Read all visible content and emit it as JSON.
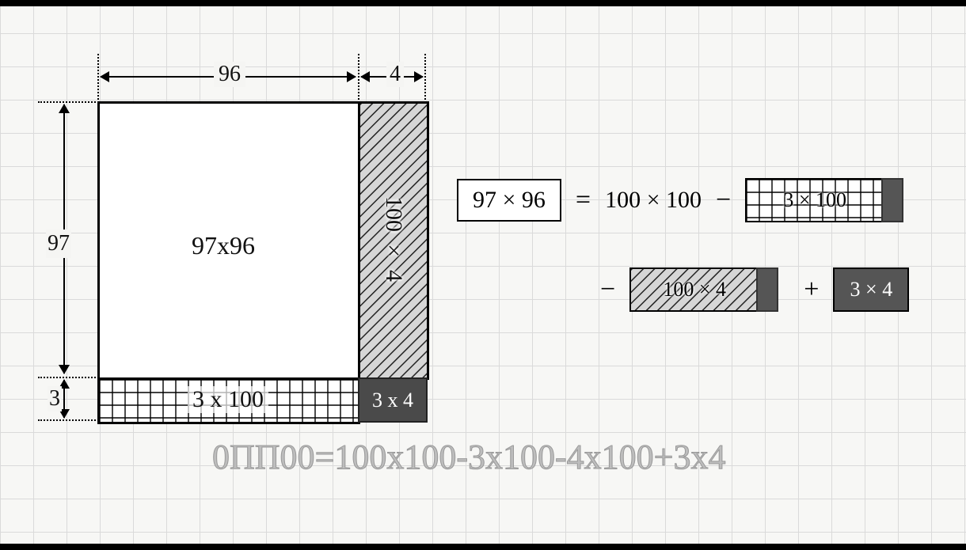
{
  "dims": {
    "top_width_main": "96",
    "top_width_side": "4",
    "left_height_main": "97",
    "left_height_bottom": "3"
  },
  "areas": {
    "main": "97x96",
    "right": "100 × 4",
    "bottom": "3 x 100",
    "corner": "3 x 4"
  },
  "equation": {
    "lhs": "97 × 96",
    "eq": "=",
    "t1": "100 × 100",
    "minus": "−",
    "t2": "3 × 100",
    "t3": "100 × 4",
    "plus": "+",
    "t4": "3 × 4"
  },
  "caption_prefix": "0ПП00",
  "caption_rest": "=100x100-3x100-4x100+3x4"
}
